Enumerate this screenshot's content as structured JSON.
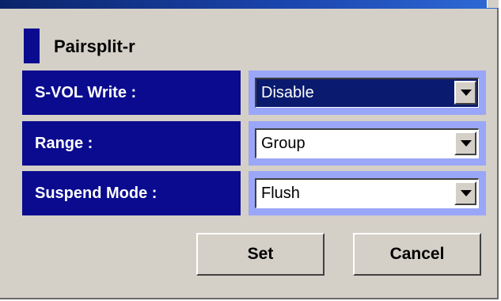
{
  "section": {
    "title": "Pairsplit-r"
  },
  "fields": [
    {
      "label": "S-VOL Write :",
      "value": "Disable",
      "highlighted": true
    },
    {
      "label": "Range :",
      "value": "Group",
      "highlighted": false
    },
    {
      "label": "Suspend Mode :",
      "value": "Flush",
      "highlighted": false
    }
  ],
  "buttons": {
    "set_label": "Set",
    "cancel_label": "Cancel"
  },
  "colors": {
    "label_background": "#0b0b8f",
    "field_frame": "#9aa6f7",
    "selected_value_background": "#0a1a6e",
    "dialog_background": "#d4d0c8"
  },
  "icons": {
    "dropdown": "triangle-down-icon",
    "section_marker": "square-marker-icon"
  }
}
